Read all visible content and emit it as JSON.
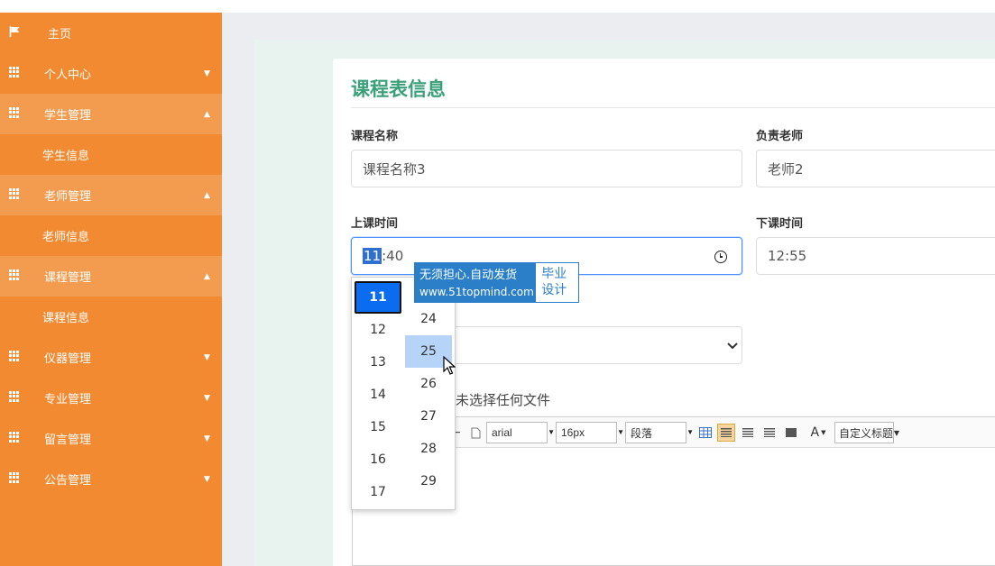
{
  "sidebar": {
    "items": [
      {
        "label": "主页",
        "icon": "flag-icon",
        "caret": ""
      },
      {
        "label": "个人中心",
        "icon": "grid-icon",
        "caret": "▼"
      },
      {
        "label": "学生管理",
        "icon": "grid-icon",
        "caret": "▲"
      },
      {
        "label": "学生信息"
      },
      {
        "label": "老师管理",
        "icon": "grid-icon",
        "caret": "▲"
      },
      {
        "label": "老师信息"
      },
      {
        "label": "课程管理",
        "icon": "grid-icon",
        "caret": "▲"
      },
      {
        "label": "课程信息"
      },
      {
        "label": "仪器管理",
        "icon": "grid-icon",
        "caret": "▼"
      },
      {
        "label": "专业管理",
        "icon": "grid-icon",
        "caret": "▼"
      },
      {
        "label": "留言管理",
        "icon": "grid-icon",
        "caret": "▼"
      },
      {
        "label": "公告管理",
        "icon": "grid-icon",
        "caret": "▼"
      }
    ]
  },
  "page": {
    "title": "课程表信息"
  },
  "form": {
    "course_name_label": "课程名称",
    "course_name_value": "课程名称3",
    "teacher_label": "负责老师",
    "teacher_value": "老师2",
    "start_label": "上课时间",
    "start_hour": "11",
    "start_rest": ":40",
    "end_label": "下课时间",
    "end_value": "12:55",
    "file_status": "未选择任何文件"
  },
  "time_picker": {
    "hours": [
      "11",
      "12",
      "13",
      "14",
      "15",
      "16",
      "17"
    ],
    "minutes": [
      "24",
      "25",
      "26",
      "27",
      "28",
      "29"
    ],
    "selected_hour": "11",
    "hovered_minute": "25"
  },
  "editor": {
    "font_family": "arial",
    "font_size": "16px",
    "paragraph": "段落",
    "custom_title": "自定义标题",
    "font_color_glyph": "A"
  },
  "watermark": {
    "line1": "无须担心.自动发货",
    "line2": "www.51topmind.com",
    "right1": "毕业",
    "right2": "设计"
  },
  "colors": {
    "sidebar": "#f28a31",
    "title": "#3aa07a",
    "selected": "#0a6cf0"
  }
}
